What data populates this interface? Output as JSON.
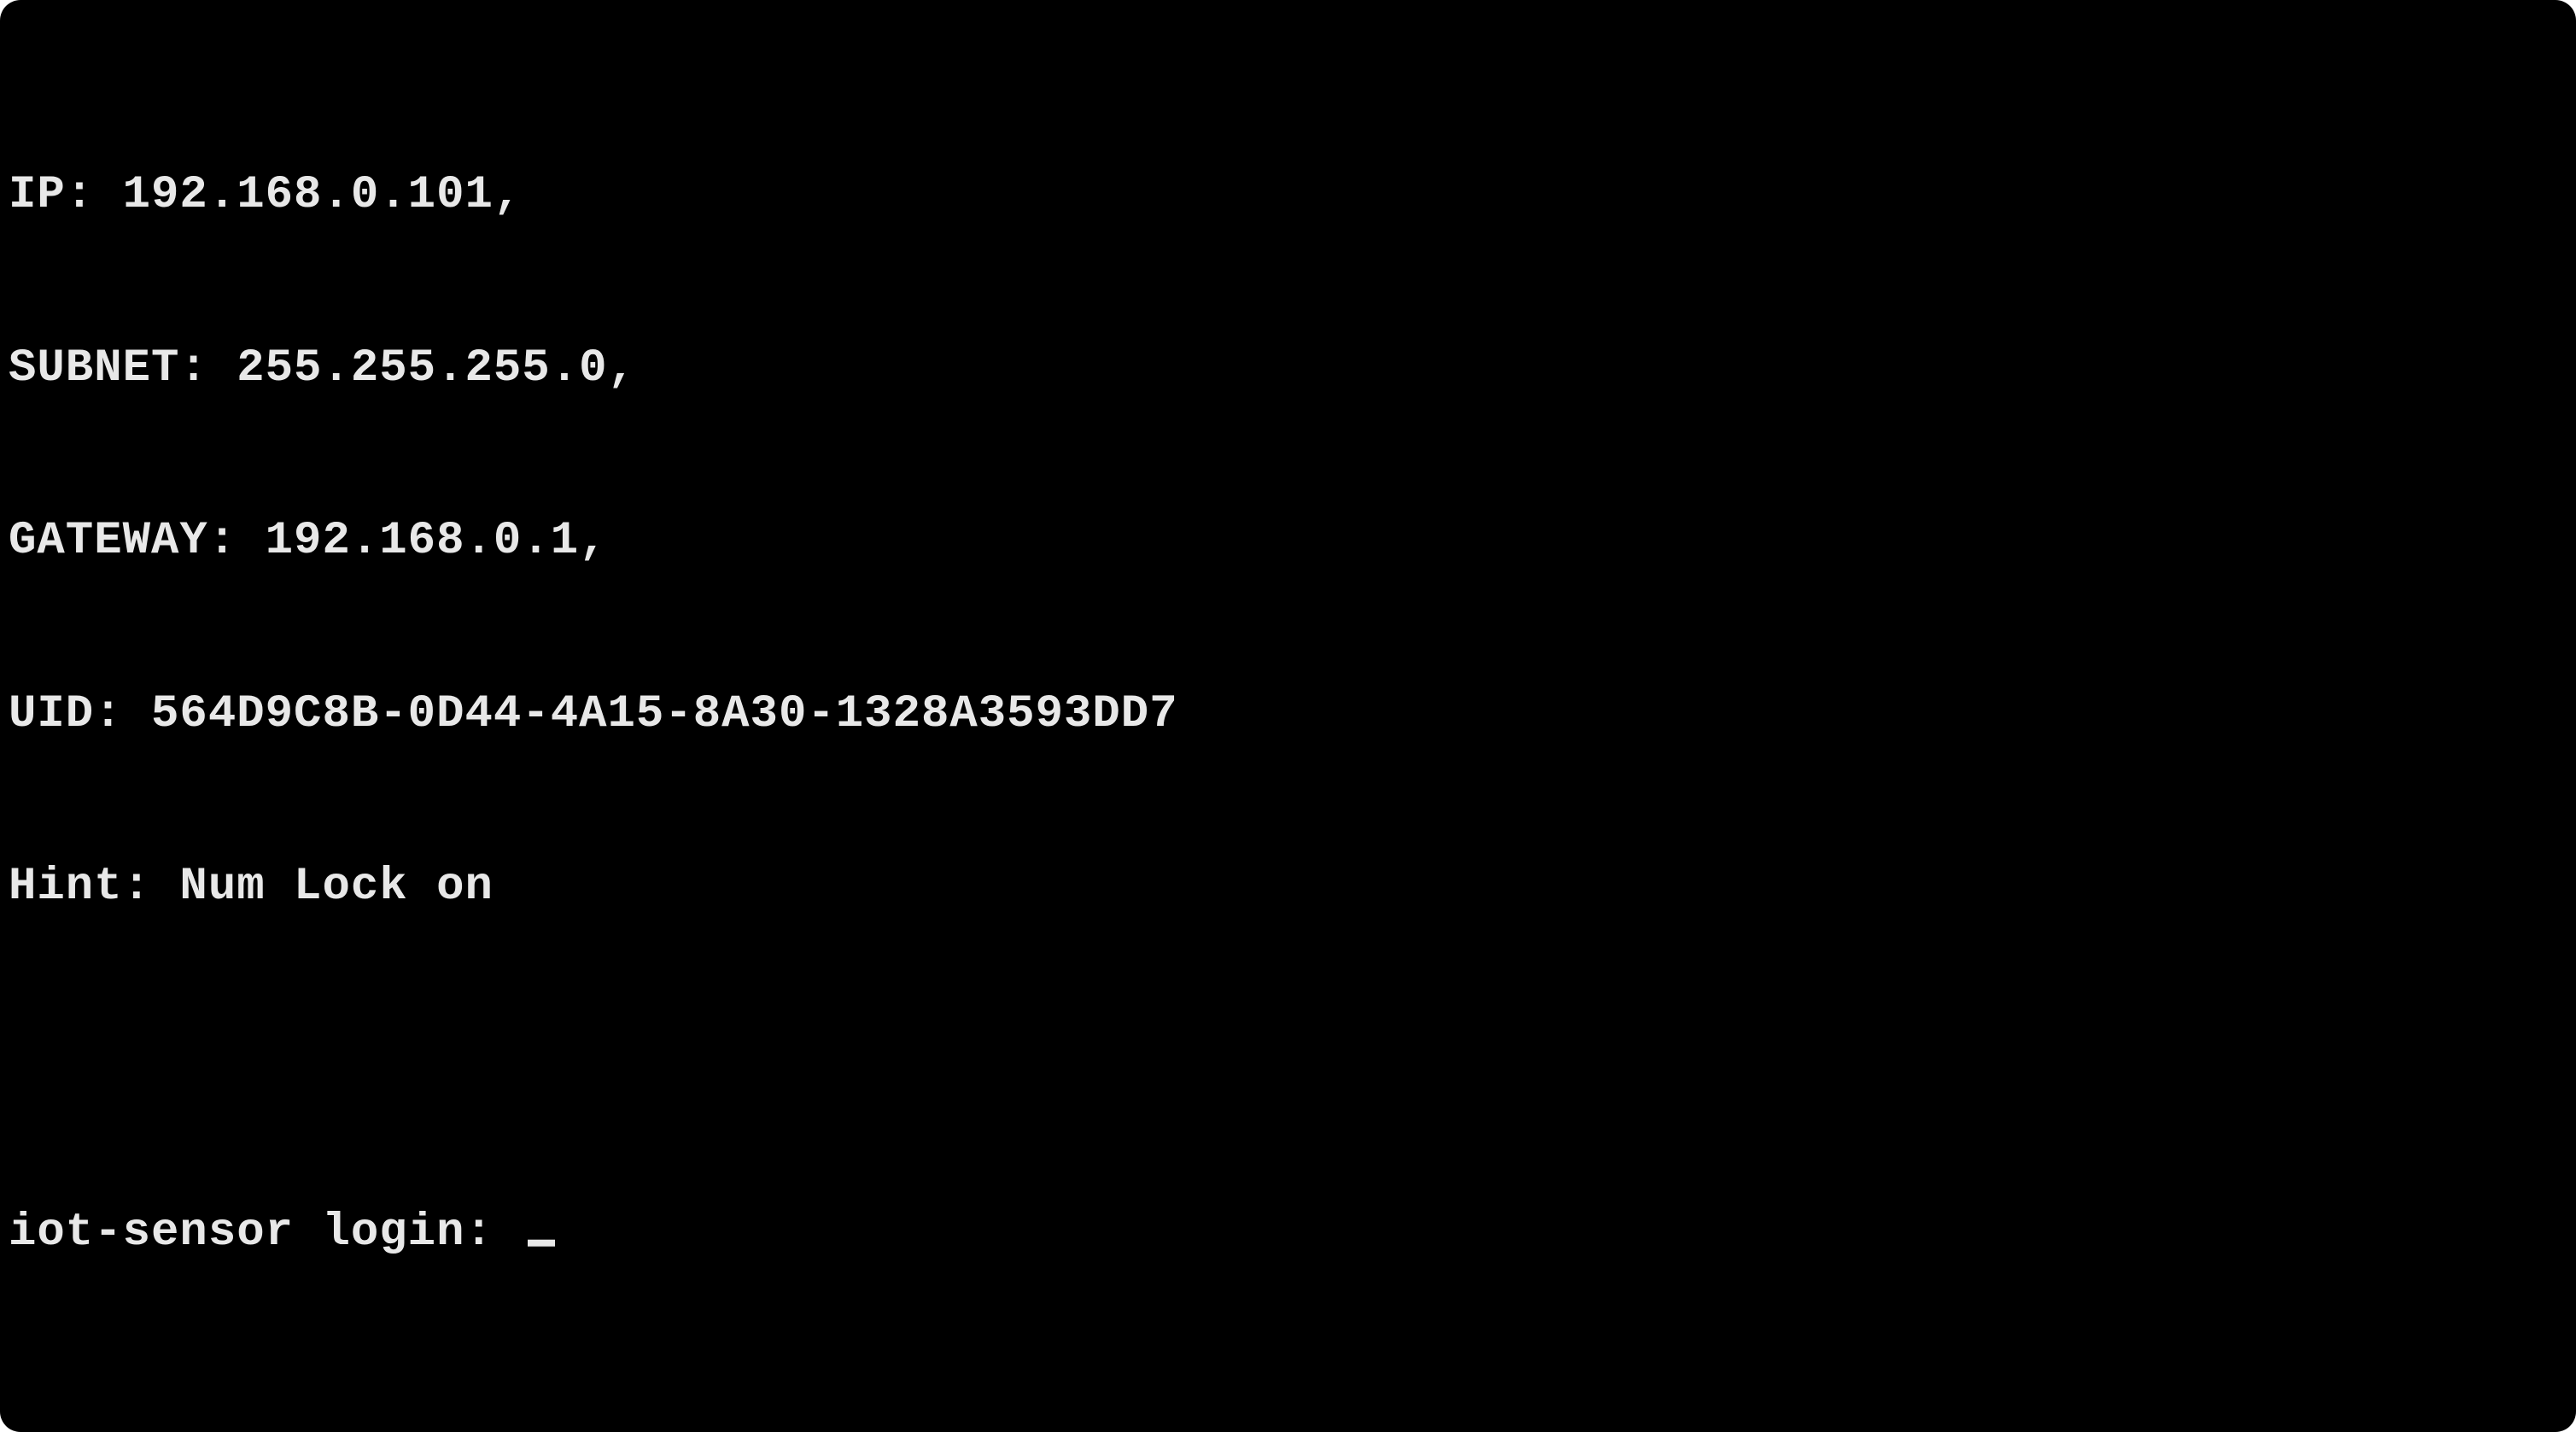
{
  "terminal": {
    "lines": {
      "ip": "IP: 192.168.0.101,",
      "subnet": "SUBNET: 255.255.255.0,",
      "gateway": "GATEWAY: 192.168.0.1,",
      "uid": "UID: 564D9C8B-0D44-4A15-8A30-1328A3593DD7",
      "hint": "Hint: Num Lock on"
    },
    "prompt": "iot-sensor login: ",
    "input_value": ""
  }
}
